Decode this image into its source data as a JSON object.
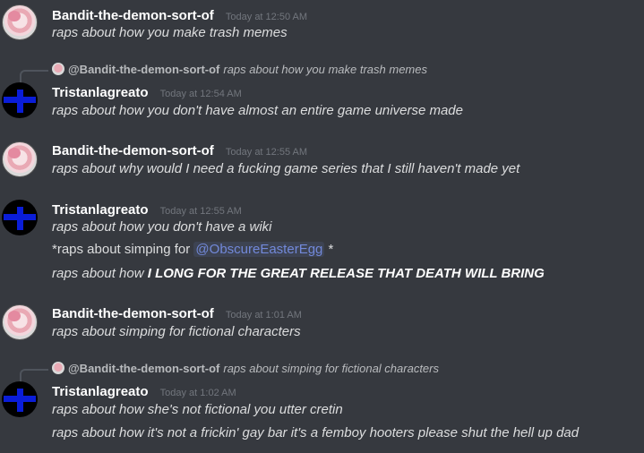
{
  "messages": [
    {
      "author": "Bandit-the-demon-sort-of",
      "time": "Today at 12:50 AM",
      "lines": [
        "raps about how you make trash memes"
      ]
    },
    {
      "reply_to": {
        "mention": "@Bandit-the-demon-sort-of",
        "text": "raps about how you make trash memes"
      },
      "author": "Tristanlagreato",
      "time": "Today at 12:54 AM",
      "lines": [
        "raps about how you don't have almost an entire game universe made"
      ]
    },
    {
      "author": "Bandit-the-demon-sort-of",
      "time": "Today at 12:55 AM",
      "lines": [
        "raps about why would I need a fucking game series that I still haven't made yet"
      ]
    },
    {
      "author": "Tristanlagreato",
      "time": "Today at 12:55 AM",
      "lines": [
        "raps about how you don't have a wiki",
        {
          "prefix": "*raps about simping for ",
          "mention": "@ObscureEasterEgg",
          "suffix": " *"
        },
        {
          "prefix": "raps about how ",
          "bold": "I LONG FOR THE GREAT RELEASE THAT DEATH WILL BRING"
        }
      ]
    },
    {
      "author": "Bandit-the-demon-sort-of",
      "time": "Today at 1:01 AM",
      "lines": [
        "raps about simping for fictional characters"
      ]
    },
    {
      "reply_to": {
        "mention": "@Bandit-the-demon-sort-of",
        "text": "raps about simping for fictional characters"
      },
      "author": "Tristanlagreato",
      "time": "Today at 1:02 AM",
      "lines": [
        "raps about how she's not fictional you utter cretin",
        "raps about how it's not a frickin' gay bar it's a femboy hooters please shut the hell up dad"
      ]
    }
  ],
  "colors": {
    "background": "#36393f",
    "username": "#ffffff",
    "timestamp": "#72767d",
    "text": "#dcddde",
    "mention": "#7289da",
    "tristan_avatar": "#0a1dd8"
  },
  "icons": {
    "bandit_avatar": "pink-anime-avatar",
    "tristan_avatar": "blue-cross-avatar"
  }
}
